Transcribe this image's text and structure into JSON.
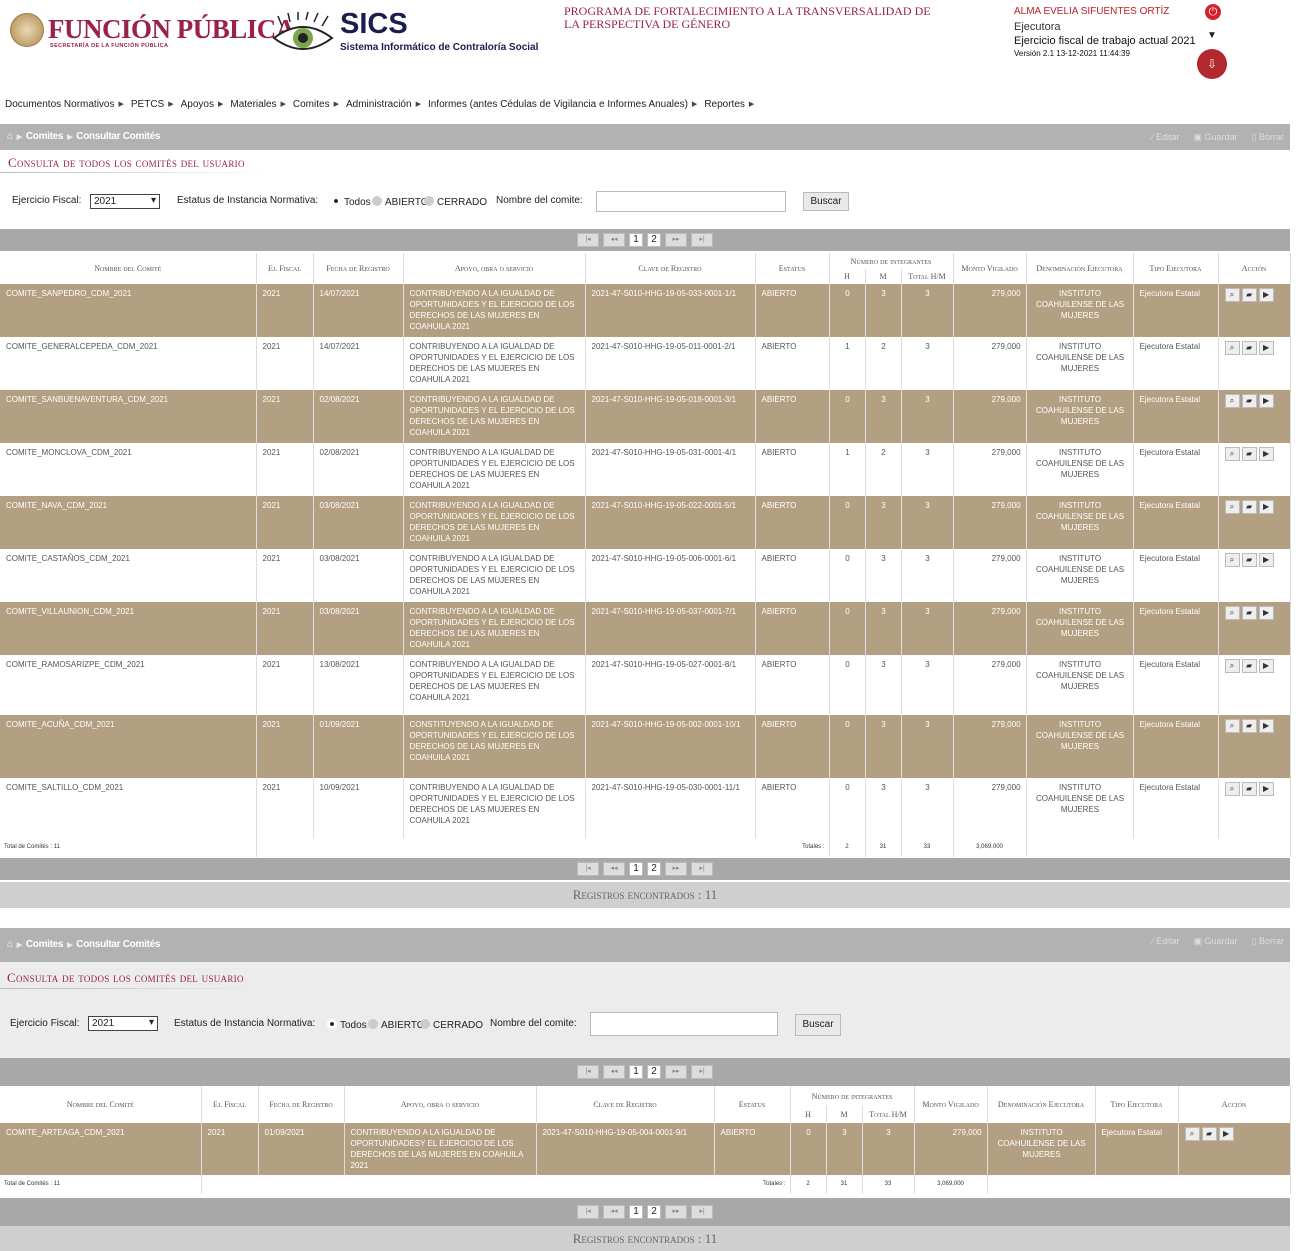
{
  "header": {
    "brand_title": "FUNCIÓN PÚBLICA",
    "brand_subtitle": "SECRETARÍA DE LA FUNCIÓN PÚBLICA",
    "sics_title": "SICS",
    "sics_subtitle": "Sistema Informático de Contraloría Social",
    "program": "PROGRAMA DE FORTALECIMIENTO A LA TRANSVERSALIDAD DE LA PERSPECTIVA DE GÉNERO",
    "user_name": "ALMA EVELIA SIFUENTES ORTÍZ",
    "role": "Ejecutora",
    "fiscal": "Ejercicio fiscal de trabajo actual 2021",
    "version": "Versión 2.1   13-12-2021 11:44:39"
  },
  "menu": [
    "Documentos Normativos",
    "PETCS",
    "Apoyos",
    "Materiales",
    "Comites",
    "Administración",
    "Informes (antes Cédulas de Vigilancia e Informes Anuales)",
    "Reportes"
  ],
  "breadcrumb": {
    "home": "⌂",
    "level1": "Comites",
    "level2": "Consultar Comités"
  },
  "toolbar": {
    "edit": "Editar",
    "save": "Guardar",
    "delete": "Borrar"
  },
  "consulta_title": "Consulta de todos los comités del usuario",
  "filters": {
    "ejercicio_label": "Ejercicio Fiscal:",
    "ejercicio_value": "2021",
    "estatus_label": "Estatus de Instancia Normativa:",
    "opt_todos": "Todos",
    "opt_abierto": "ABIERTO",
    "opt_cerrado": "CERRADO",
    "nombre_label": "Nombre del comite:",
    "buscar": "Buscar"
  },
  "pager": {
    "pages": [
      "1",
      "2"
    ]
  },
  "columns": {
    "nombre": "Nombre del Comité",
    "ejfiscal": "Ej. Fiscal",
    "fecha": "Fecha de Registro",
    "apoyo": "Apoyo, obra o servicio",
    "clave": "Clave de Registro",
    "estatus": "Estatus",
    "integrantes": "Número de integrantes",
    "h": "H",
    "m": "M",
    "total": "Total H/M",
    "monto": "Monto Vigilado",
    "denominacion": "Denominación Ejecutora",
    "tipo": "Tipo Ejecutora",
    "accion": "Acción"
  },
  "rows": [
    {
      "nombre": "COMITE_SANPEDRO_CDM_2021",
      "ej": "2021",
      "fecha": "14/07/2021",
      "apoyo": "CONTRIBUYENDO A LA IGUALDAD DE OPORTUNIDADES Y EL EJERCICIO DE LOS DERECHOS DE LAS MUJERES EN COAHUILA 2021",
      "clave": "2021-47-S010-HHG-19-05-033-0001-1/1",
      "estatus": "ABIERTO",
      "h": "0",
      "m": "3",
      "t": "3",
      "monto": "279,000",
      "den": "INSTITUTO COAHUILENSE DE LAS MUJERES",
      "tipo": "Ejecutora Estatal"
    },
    {
      "nombre": "COMITE_GENERALCEPEDA_CDM_2021",
      "ej": "2021",
      "fecha": "14/07/2021",
      "apoyo": "CONTRIBUYENDO A LA IGUALDAD DE OPORTUNIDADES Y EL EJERCICIO DE LOS DERECHOS DE LAS MUJERES EN COAHUILA 2021",
      "clave": "2021-47-S010-HHG-19-05-011-0001-2/1",
      "estatus": "ABIERTO",
      "h": "1",
      "m": "2",
      "t": "3",
      "monto": "279,000",
      "den": "INSTITUTO COAHUILENSE DE LAS MUJERES",
      "tipo": "Ejecutora Estatal"
    },
    {
      "nombre": "COMITE_SANBUENAVENTURA_CDM_2021",
      "ej": "2021",
      "fecha": "02/08/2021",
      "apoyo": "CONTRIBUYENDO A LA IGUALDAD DE OPORTUNIDADES Y EL EJERCICIO DE LOS DERECHOS DE LAS MUJERES EN COAHUILA 2021",
      "clave": "2021-47-S010-HHG-19-05-018-0001-3/1",
      "estatus": "ABIERTO",
      "h": "0",
      "m": "3",
      "t": "3",
      "monto": "279,000",
      "den": "INSTITUTO COAHUILENSE DE LAS MUJERES",
      "tipo": "Ejecutora Estatal"
    },
    {
      "nombre": "COMITE_MONCLOVA_CDM_2021",
      "ej": "2021",
      "fecha": "02/08/2021",
      "apoyo": "CONTRIBUYENDO A LA IGUALDAD DE OPORTUNIDADES Y EL EJERCICIO DE LOS DERECHOS DE LAS MUJERES EN COAHUILA 2021",
      "clave": "2021-47-S010-HHG-19-05-031-0001-4/1",
      "estatus": "ABIERTO",
      "h": "1",
      "m": "2",
      "t": "3",
      "monto": "279,000",
      "den": "INSTITUTO COAHUILENSE DE LAS MUJERES",
      "tipo": "Ejecutora Estatal"
    },
    {
      "nombre": "COMITE_NAVA_CDM_2021",
      "ej": "2021",
      "fecha": "03/08/2021",
      "apoyo": "CONTRIBUYENDO A LA IGUALDAD DE OPORTUNIDADES Y EL EJERCICIO DE LOS DERECHOS DE LAS MUJERES EN COAHUILA 2021",
      "clave": "2021-47-S010-HHG-19-05-022-0001-5/1",
      "estatus": "ABIERTO",
      "h": "0",
      "m": "3",
      "t": "3",
      "monto": "279,000",
      "den": "INSTITUTO COAHUILENSE DE LAS MUJERES",
      "tipo": "Ejecutora Estatal"
    },
    {
      "nombre": "COMITE_CASTAÑOS_CDM_2021",
      "ej": "2021",
      "fecha": "03/08/2021",
      "apoyo": "CONTRIBUYENDO A LA IGUALDAD DE OPORTUNIDADES Y EL EJERCICIO DE LOS DERECHOS DE LAS MUJERES EN COAHUILA 2021",
      "clave": "2021-47-S010-HHG-19-05-006-0001-6/1",
      "estatus": "ABIERTO",
      "h": "0",
      "m": "3",
      "t": "3",
      "monto": "279,000",
      "den": "INSTITUTO COAHUILENSE DE LAS MUJERES",
      "tipo": "Ejecutora Estatal"
    },
    {
      "nombre": "COMITE_VILLAUNION_CDM_2021",
      "ej": "2021",
      "fecha": "03/08/2021",
      "apoyo": "CONTRIBUYENDO A LA IGUALDAD DE OPORTUNIDADES Y EL EJERCICIO DE LOS DERECHOS DE LAS MUJERES EN COAHUILA 2021",
      "clave": "2021-47-S010-HHG-19-05-037-0001-7/1",
      "estatus": "ABIERTO",
      "h": "0",
      "m": "3",
      "t": "3",
      "monto": "279,000",
      "den": "INSTITUTO COAHUILENSE DE LAS MUJERES",
      "tipo": "Ejecutora Estatal"
    },
    {
      "nombre": "COMITE_RAMOSARIZPE_CDM_2021",
      "ej": "2021",
      "fecha": "13/08/2021",
      "apoyo": "CONTRIBUYENDO A LA IGUALDAD DE OPORTUNIDADES Y EL EJERCICIO DE LOS DERECHOS DE LAS MUJERES EN COAHUILA 2021",
      "clave": "2021-47-S010-HHG-19-05-027-0001-8/1",
      "estatus": "ABIERTO",
      "h": "0",
      "m": "3",
      "t": "3",
      "monto": "279,000",
      "den": "INSTITUTO COAHUILENSE DE LAS MUJERES",
      "tipo": "Ejecutora Estatal"
    },
    {
      "nombre": "COMITE_ACUÑA_CDM_2021",
      "ej": "2021",
      "fecha": "01/09/2021",
      "apoyo": "CONSTITUYENDO A LA IGUALDAD DE OPORTUNIDADES Y EL EJERCICIO DE LOS DERECHOS DE LAS MUJERES EN COAHUILA 2021",
      "clave": "2021-47-S010-HHG-19-05-002-0001-10/1",
      "estatus": "ABIERTO",
      "h": "0",
      "m": "3",
      "t": "3",
      "monto": "279,000",
      "den": "INSTITUTO COAHUILENSE DE LAS MUJERES",
      "tipo": "Ejecutora Estatal"
    },
    {
      "nombre": "COMITE_SALTILLO_CDM_2021",
      "ej": "2021",
      "fecha": "10/09/2021",
      "apoyo": "CONTRIBUYENDO A LA IGUALDAD DE OPORTUNIDADES Y EL EJERCICIO DE LOS DERECHOS DE LAS MUJERES EN COAHUILA 2021",
      "clave": "2021-47-S010-HHG-19-05-030-0001-11/1",
      "estatus": "ABIERTO",
      "h": "0",
      "m": "3",
      "t": "3",
      "monto": "279,000",
      "den": "INSTITUTO COAHUILENSE DE LAS MUJERES",
      "tipo": "Ejecutora Estatal"
    }
  ],
  "rows2": [
    {
      "nombre": "COMITE_ARTEAGA_CDM_2021",
      "ej": "2021",
      "fecha": "01/09/2021",
      "apoyo": "CONTRIBUYENDO A LA IGUALDAD DE OPORTUNIDADESY EL EJERCICIO DE LOS DERECHOS DE LAS MUJERES EN COAHUILA 2021",
      "clave": "2021-47-S010-HHG-19-05-004-0001-9/1",
      "estatus": "ABIERTO",
      "h": "0",
      "m": "3",
      "t": "3",
      "monto": "279,000",
      "den": "INSTITUTO COAHUILENSE DE LAS MUJERES",
      "tipo": "Ejecutora Estatal"
    }
  ],
  "totals": {
    "label": "Total de Comités : 11",
    "tot_label": "Totales :",
    "h": "2",
    "m": "31",
    "t": "33",
    "monto": "3,069,000"
  },
  "registros": "Registros encontrados : 11",
  "colors": {
    "brand": "#9b2247",
    "row_dark": "#b39f81",
    "bar": "#b2b2b2"
  }
}
